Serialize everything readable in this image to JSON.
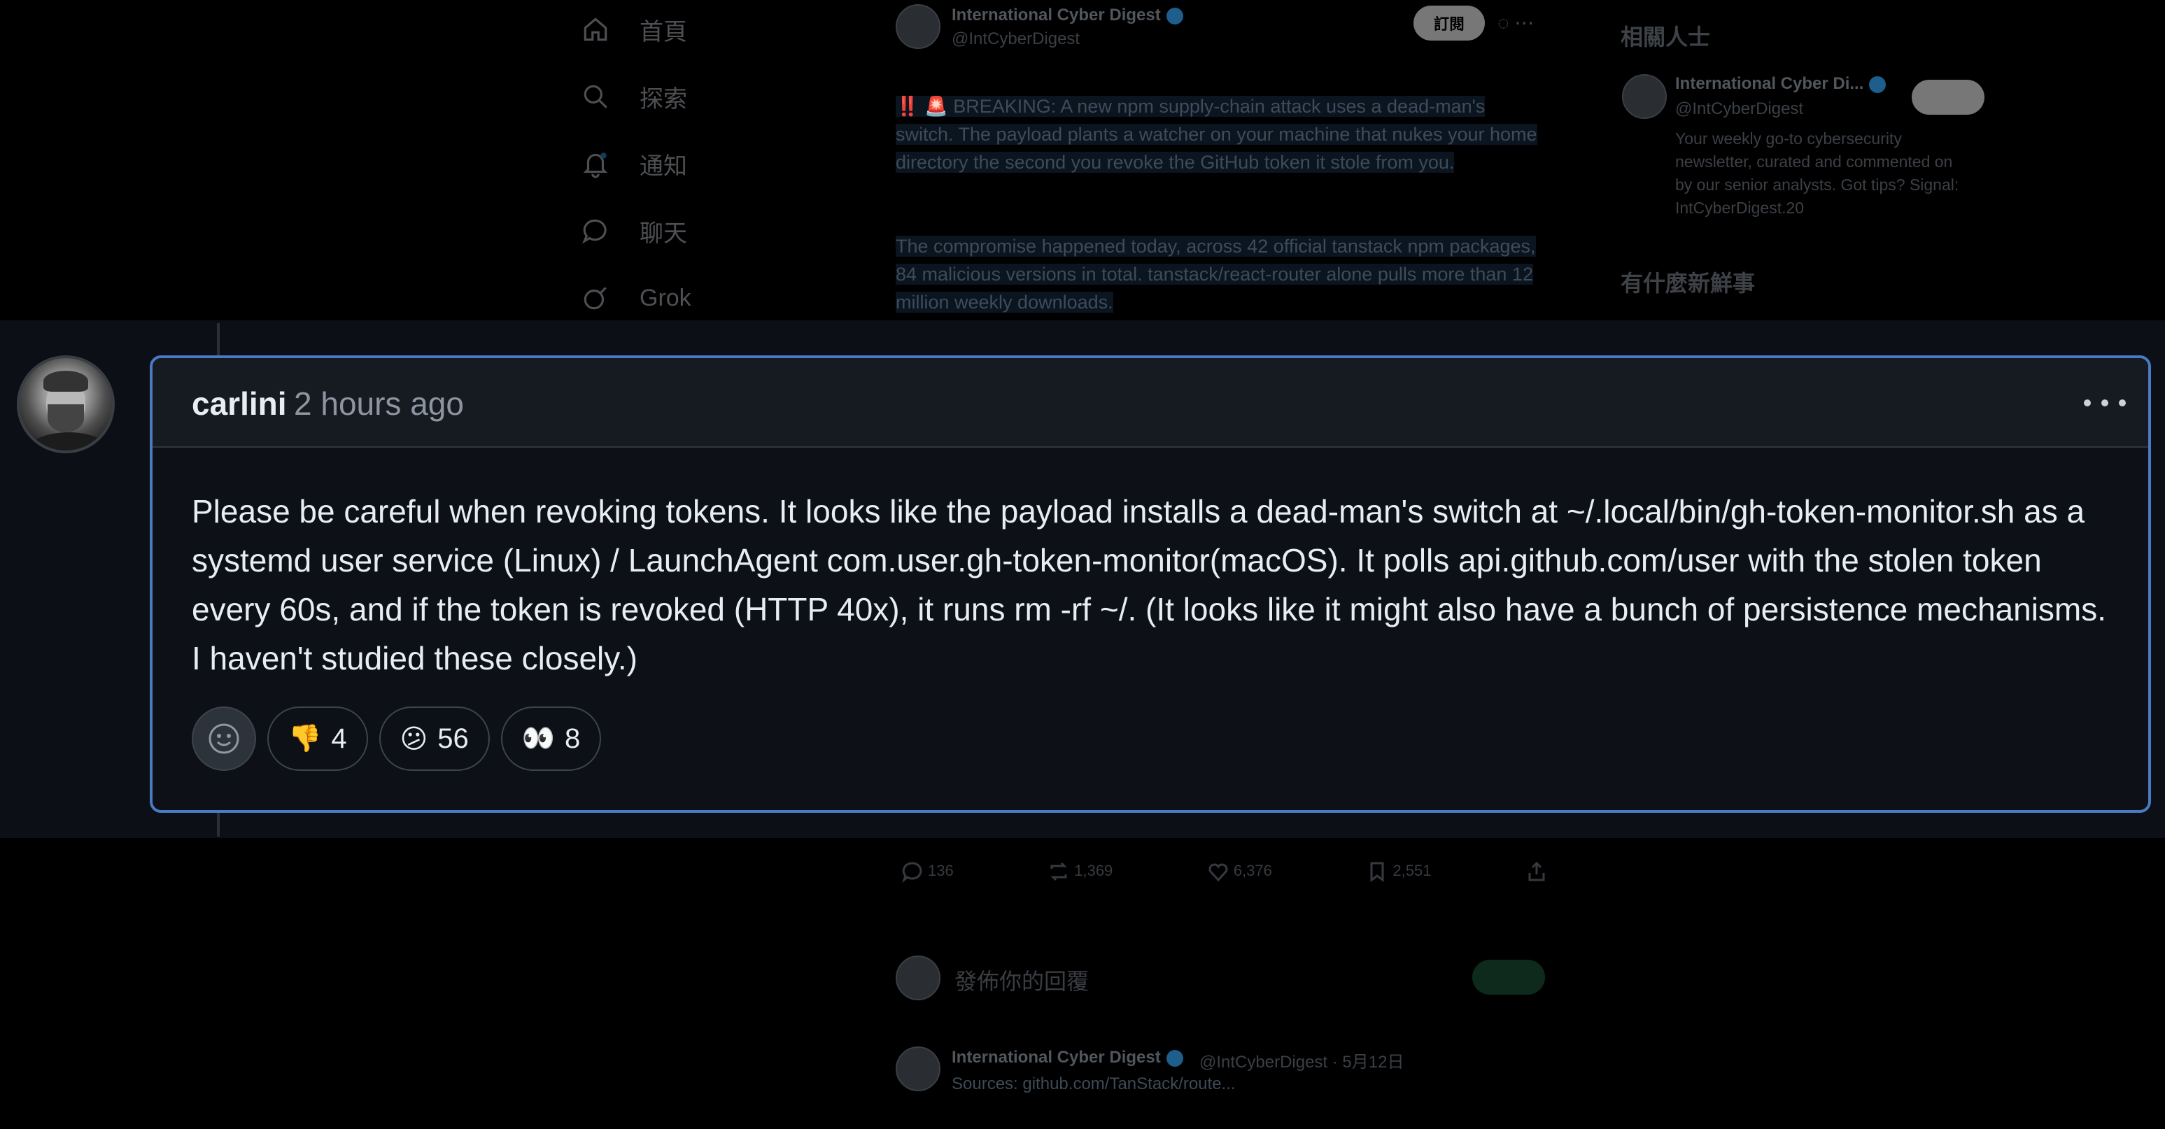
{
  "x_background": {
    "nav": [
      {
        "icon": "home-icon",
        "label": "首頁"
      },
      {
        "icon": "search-icon",
        "label": "探索"
      },
      {
        "icon": "bell-icon",
        "label": "通知"
      },
      {
        "icon": "chat-icon",
        "label": "聊天"
      },
      {
        "icon": "grok-icon",
        "label": "Grok"
      }
    ],
    "tweet": {
      "author": "International Cyber Digest",
      "handle": "@IntCyberDigest",
      "subscribe_label": "訂閱",
      "text_1": "‼️ 🚨 BREAKING: A new npm supply-chain attack uses a dead-man's switch. The payload plants a watcher on your machine that nukes your home directory the second you revoke the GitHub token it stole from you.",
      "text_2": "The compromise happened today, across 42 official tanstack npm packages, 84 malicious versions in total. tanstack/react-router alone pulls more than 12 million weekly downloads.",
      "stats": {
        "replies": "136",
        "reposts": "1,369",
        "likes": "6,376",
        "bookmarks": "2,551"
      },
      "reply_placeholder": "發佈你的回覆",
      "reply_author": "International Cyber Digest",
      "reply_handle": "@IntCyberDigest · 5月12日",
      "reply_text": "Sources: github.com/TanStack/route..."
    },
    "sidebar": {
      "related_heading": "相關人士",
      "related_name": "International Cyber Di...",
      "related_handle": "@IntCyberDigest",
      "related_bio": "Your weekly go-to cybersecurity newsletter, curated and commented on by our senior analysts. Got tips? Signal: IntCyberDigest.20",
      "trending_heading": "有什麼新鮮事"
    }
  },
  "comment": {
    "author": "carlini",
    "timestamp": "2 hours ago",
    "body": "Please be careful when revoking tokens. It looks like the payload installs a dead-man's switch at ~/.local/bin/gh-token-monitor.sh as a systemd user service (Linux) / LaunchAgent com.user.gh-token-monitor(macOS). It polls api.github.com/user with the stolen token every 60s, and if the token is revoked (HTTP 40x), it runs rm -rf ~/. (It looks like it might also have a bunch of persistence mechanisms. I haven't studied these closely.)",
    "reactions": [
      {
        "emoji": "👎",
        "icon": "thumbs-down-icon",
        "count": "4"
      },
      {
        "emoji": "😕",
        "icon": "confused-face-icon",
        "count": "56"
      },
      {
        "emoji": "👀",
        "icon": "eyes-icon",
        "count": "8"
      }
    ]
  },
  "colors": {
    "card_border": "#4a7ac4",
    "card_bg": "#0d1117",
    "header_bg": "#161b22"
  }
}
